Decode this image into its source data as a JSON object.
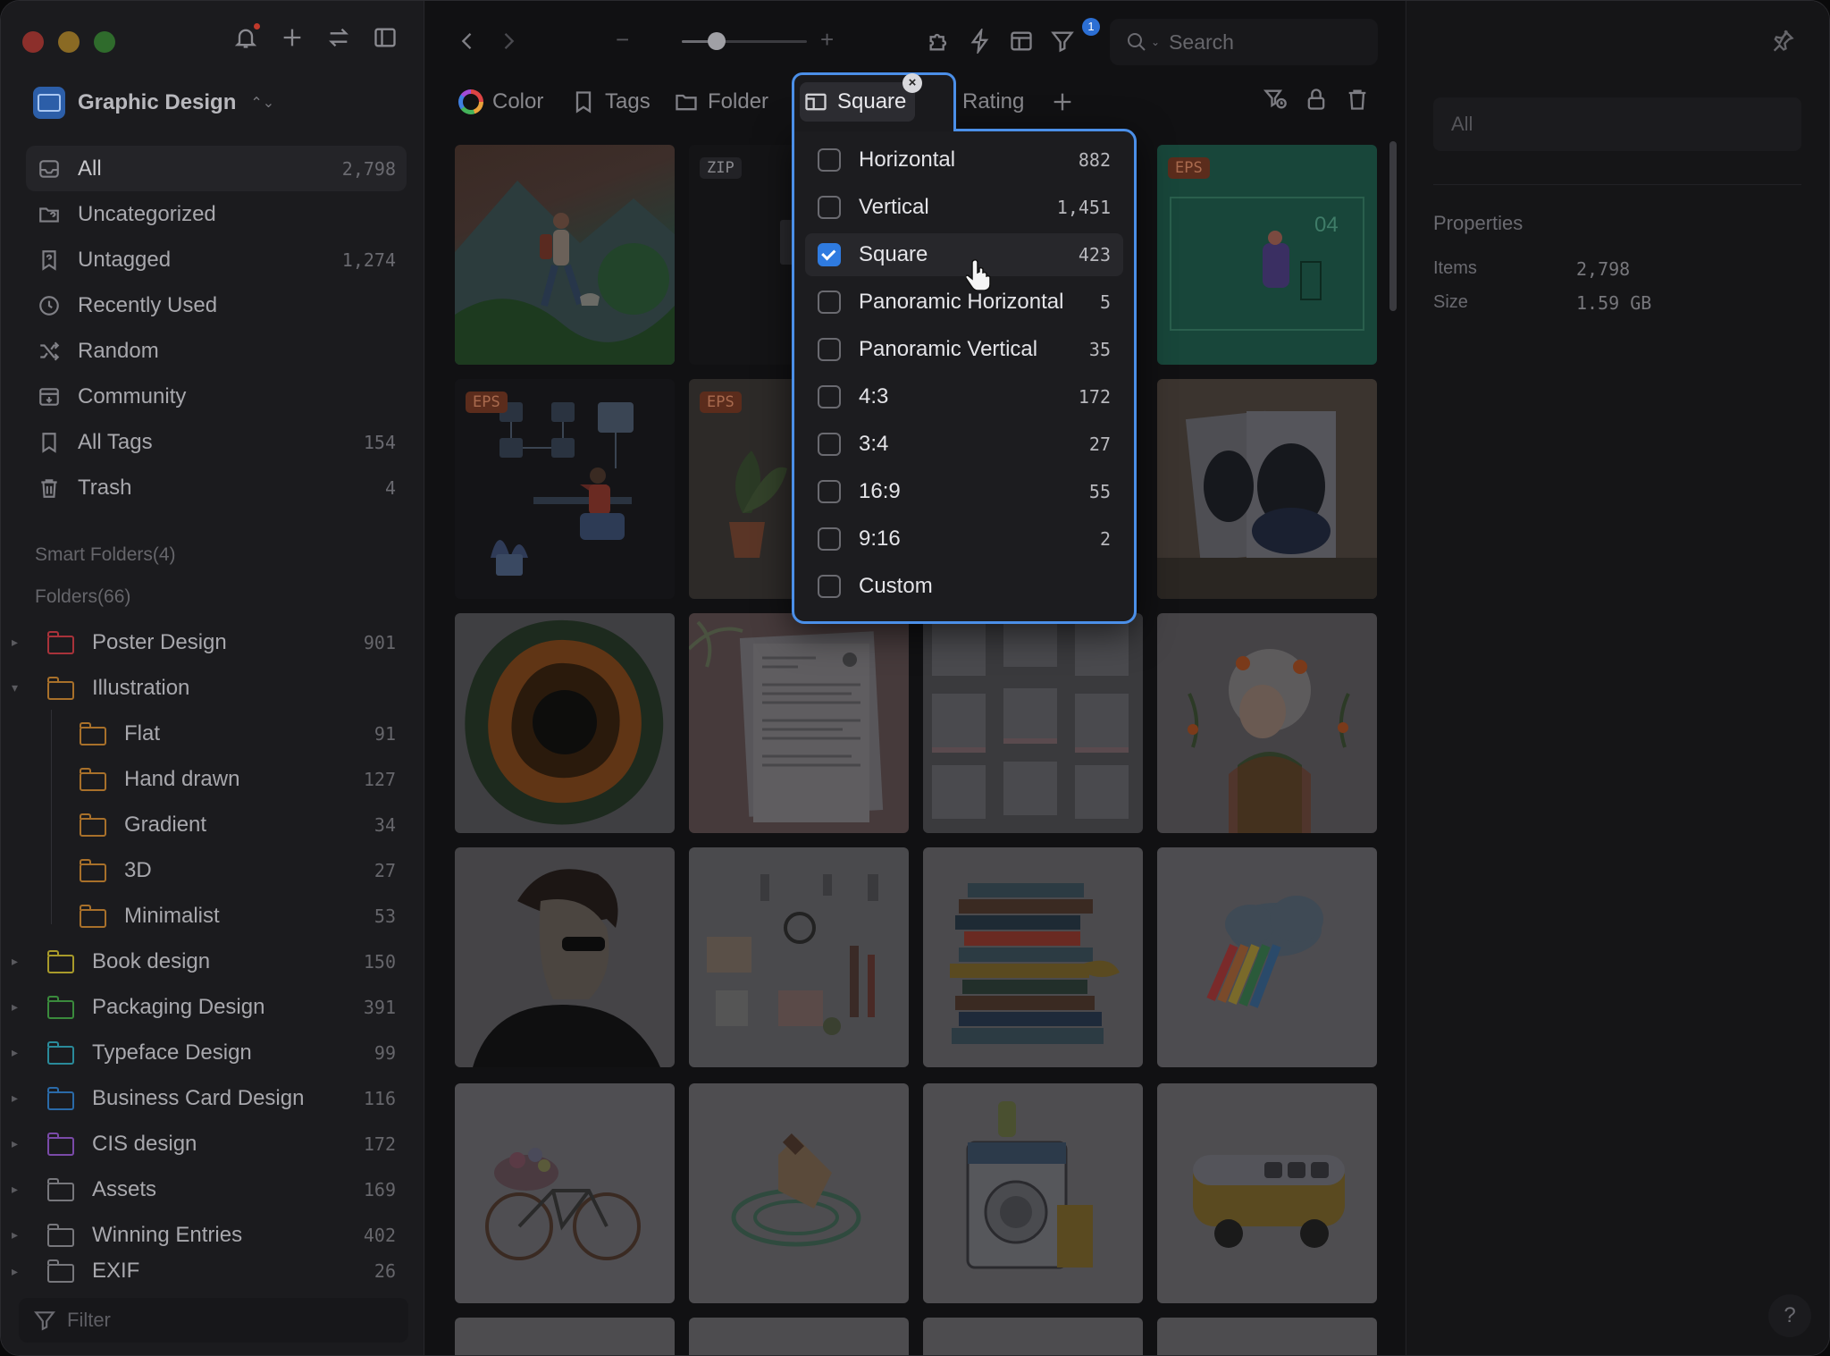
{
  "sidebar": {
    "library_name": "Graphic Design",
    "nav": [
      {
        "label": "All",
        "count": "2,798"
      },
      {
        "label": "Uncategorized",
        "count": ""
      },
      {
        "label": "Untagged",
        "count": "1,274"
      },
      {
        "label": "Recently Used",
        "count": ""
      },
      {
        "label": "Random",
        "count": ""
      },
      {
        "label": "Community",
        "count": ""
      },
      {
        "label": "All Tags",
        "count": "154"
      },
      {
        "label": "Trash",
        "count": "4"
      }
    ],
    "smart_folders": "Smart Folders(4)",
    "folders_header": "Folders(66)",
    "folders": [
      {
        "label": "Poster Design",
        "count": "901",
        "color": "#a8323a"
      },
      {
        "label": "Illustration",
        "count": "",
        "color": "#a8702a"
      },
      {
        "label": "Flat",
        "count": "91",
        "color": "#a8702a"
      },
      {
        "label": "Hand drawn",
        "count": "127",
        "color": "#a8702a"
      },
      {
        "label": "Gradient",
        "count": "34",
        "color": "#a8702a"
      },
      {
        "label": "3D",
        "count": "27",
        "color": "#a8702a"
      },
      {
        "label": "Minimalist",
        "count": "53",
        "color": "#a8702a"
      },
      {
        "label": "Book design",
        "count": "150",
        "color": "#a89a2a"
      },
      {
        "label": "Packaging Design",
        "count": "391",
        "color": "#3a8a3c"
      },
      {
        "label": "Typeface Design",
        "count": "99",
        "color": "#2a8a9a"
      },
      {
        "label": "Business Card Design",
        "count": "116",
        "color": "#2a6aa8"
      },
      {
        "label": "CIS design",
        "count": "172",
        "color": "#7a4aa8"
      },
      {
        "label": "Assets",
        "count": "169",
        "color": "#77777c"
      },
      {
        "label": "Winning Entries",
        "count": "402",
        "color": "#77777c"
      },
      {
        "label": "EXIF",
        "count": "26",
        "color": "#77777c"
      }
    ],
    "filter_placeholder": "Filter"
  },
  "toolbar": {
    "search_placeholder": "Search",
    "filter_badge": "1"
  },
  "filters": {
    "color": "Color",
    "tags": "Tags",
    "folder": "Folder",
    "shape": "Square",
    "rating": "Rating"
  },
  "shape_menu": [
    {
      "label": "Horizontal",
      "count": "882",
      "checked": false
    },
    {
      "label": "Vertical",
      "count": "1,451",
      "checked": false
    },
    {
      "label": "Square",
      "count": "423",
      "checked": true
    },
    {
      "label": "Panoramic Horizontal",
      "count": "5",
      "checked": false
    },
    {
      "label": "Panoramic Vertical",
      "count": "35",
      "checked": false
    },
    {
      "label": "4:3",
      "count": "172",
      "checked": false
    },
    {
      "label": "3:4",
      "count": "27",
      "checked": false
    },
    {
      "label": "16:9",
      "count": "55",
      "checked": false
    },
    {
      "label": "9:16",
      "count": "2",
      "checked": false
    },
    {
      "label": "Custom",
      "count": "",
      "checked": false
    }
  ],
  "grid_badges": {
    "eps": "EPS",
    "zip": "ZIP",
    "slide_number": "04"
  },
  "right_panel": {
    "input_value": "All",
    "properties_title": "Properties",
    "items_label": "Items",
    "items_value": "2,798",
    "size_label": "Size",
    "size_value": "1.59 GB",
    "help": "?"
  }
}
